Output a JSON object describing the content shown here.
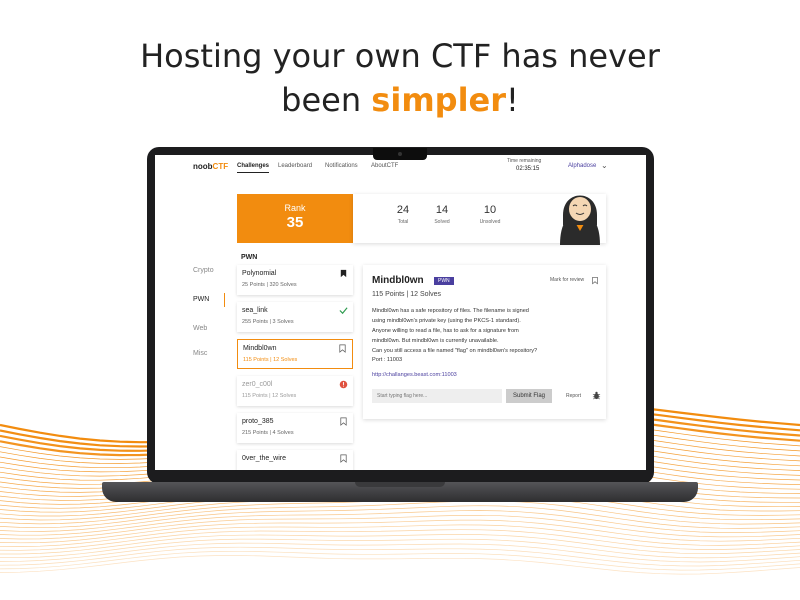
{
  "headline": {
    "line1": "Hosting your own CTF has never",
    "line2_pre": "been ",
    "line2_accent": "simpler",
    "line2_post": "!"
  },
  "colors": {
    "accent": "#f28c0f",
    "purple": "#4a3f9f"
  },
  "app": {
    "logo_main": "noob",
    "logo_accent": "CTF",
    "nav": [
      "Challenges",
      "Leaderboard",
      "Notifications",
      "AboutCTF"
    ],
    "time_label": "Time remaining",
    "time_value": "02:35:15",
    "user": "Alphadose",
    "rank_label": "Rank",
    "rank_value": "35",
    "stats": [
      {
        "value": "24",
        "label": "Total"
      },
      {
        "value": "14",
        "label": "Solved"
      },
      {
        "value": "10",
        "label": "Unsolved"
      }
    ],
    "categories": [
      "Crypto",
      "PWN",
      "Web",
      "Misc"
    ],
    "list_header": "PWN",
    "challenges": [
      {
        "name": "Polynomial",
        "points": "25 Points",
        "solves": "320 Solves",
        "icon": "bookmark-filled-icon"
      },
      {
        "name": "sea_link",
        "points": "255 Points",
        "solves": "3 Solves",
        "icon": "check-icon"
      },
      {
        "name": "Mindbl0wn",
        "points": "115 Points",
        "solves": "12 Solves",
        "icon": "bookmark-icon"
      },
      {
        "name": "zer0_c00l",
        "points": "115 Points",
        "solves": "12 Solves",
        "icon": "alert-icon"
      },
      {
        "name": "proto_385",
        "points": "215 Points",
        "solves": "4 Solves",
        "icon": "bookmark-icon"
      },
      {
        "name": "0ver_the_wire",
        "points": "",
        "solves": "",
        "icon": "bookmark-icon"
      }
    ],
    "detail": {
      "title": "Mindbl0wn",
      "tag": "PWN",
      "mark": "Mark for review",
      "meta": "115 Points | 12 Solves",
      "desc": [
        "Mindbl0wn has a safe repository of files. The filename is signed",
        "using mindbl0wn's private key (using the PKCS-1 standard).",
        "Anyone willing to read a file, has to ask for a signature from",
        "mindbl0wn. But mindbl0wn is currently unavailable.",
        "Can you still access a file named \"flag\" on mindbl0wn's repository?"
      ],
      "port": "Port : 11003",
      "link": "http://challanges.beast.com:11003",
      "flag_placeholder": "Start typing flag here...",
      "submit": "Submit Flag",
      "report": "Report"
    }
  }
}
